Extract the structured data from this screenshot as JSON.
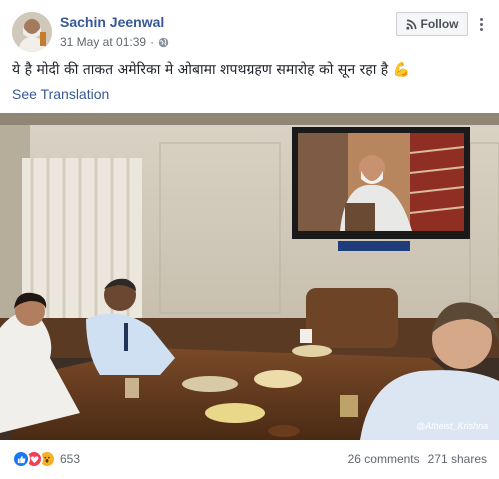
{
  "post": {
    "author": "Sachin Jeenwal",
    "timestamp": "31 May at 01:39",
    "separator": "·",
    "privacy_icon": "globe-icon",
    "follow_label": "Follow",
    "text": "ये है मोदी की ताकत अमेरिका मे ओबामा शपथग्रहण समारोह को सून रहा है",
    "text_emoji": "💪",
    "translate_label": "See Translation",
    "photo_watermark": "@Atheist_Krishna",
    "reactions": [
      "like",
      "love",
      "wow"
    ],
    "reaction_count": "653",
    "comments": "26 comments",
    "shares": "271 shares"
  },
  "colors": {
    "link": "#365899",
    "like": "#1877f2",
    "love": "#f33e58",
    "wow": "#f7b125"
  }
}
